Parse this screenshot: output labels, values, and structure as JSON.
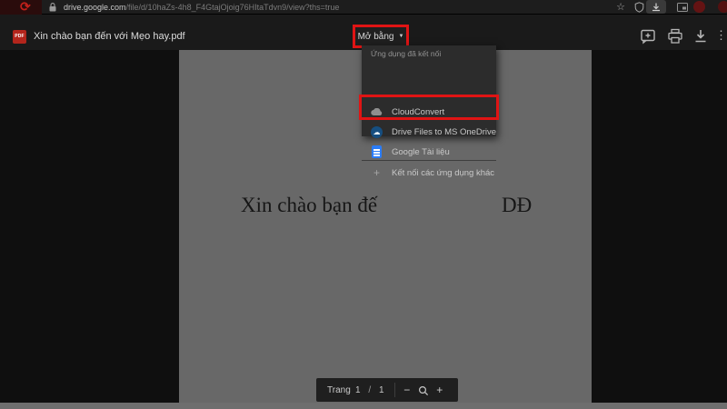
{
  "browser": {
    "url_host": "drive.google.com",
    "url_path": "/file/d/10haZs-4h8_F4GtajOjoig76HItaTdvn9/view?ths=true"
  },
  "viewer": {
    "file_badge": "PDF",
    "file_name": "Xin chào bạn đến với Mẹo hay.pdf",
    "open_with_label": "Mở bằng",
    "open_with_caret": "▼"
  },
  "dropdown": {
    "header": "Ứng dụng đã kết nối",
    "items": [
      {
        "label": "CloudConvert"
      },
      {
        "label": "Drive Files to MS OneDrive"
      },
      {
        "label": "Google Tài liệu"
      },
      {
        "label": "Kết nối các ứng dụng khác"
      }
    ]
  },
  "document": {
    "text_left": "Xin chào bạn đế",
    "text_right": "DĐ"
  },
  "pager": {
    "page_label": "Trang",
    "current_page": "1",
    "separator": "/",
    "total_pages": "1",
    "minus": "−",
    "plus": "+"
  },
  "colors": {
    "annotation_red": "#e01414",
    "page_gray": "#686868",
    "docs_blue": "#2a7cf7",
    "onedrive_blue": "#164e80",
    "pdf_badge_red": "#b3251c"
  }
}
